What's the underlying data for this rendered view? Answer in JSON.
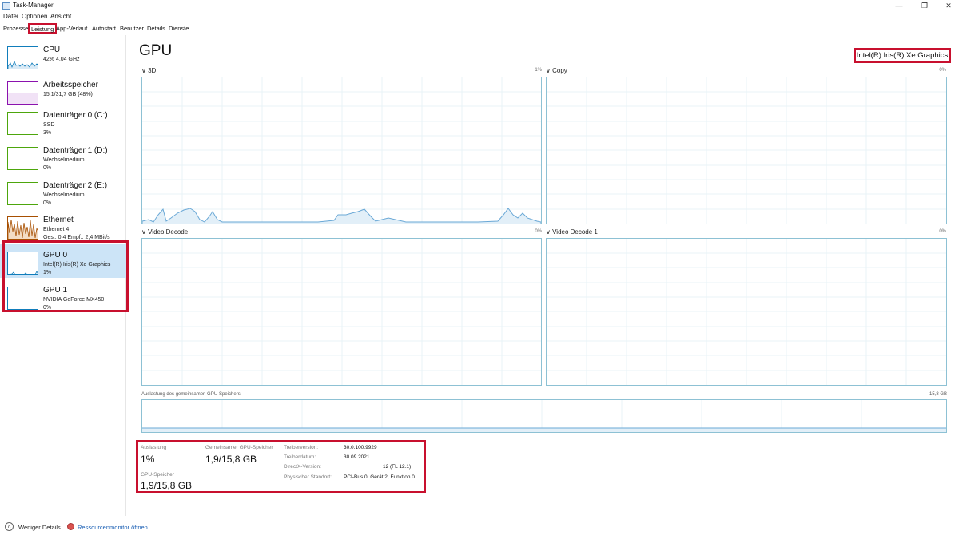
{
  "window": {
    "title": "Task-Manager"
  },
  "menu": [
    "Datei",
    "Optionen",
    "Ansicht"
  ],
  "tabs": [
    {
      "label": "Prozesse",
      "active": false
    },
    {
      "label": "Leistung",
      "active": true
    },
    {
      "label": "App-Verlauf",
      "active": false
    },
    {
      "label": "Autostart",
      "active": false
    },
    {
      "label": "Benutzer",
      "active": false
    },
    {
      "label": "Details",
      "active": false
    },
    {
      "label": "Dienste",
      "active": false
    }
  ],
  "sidebar": {
    "items": [
      {
        "name": "CPU",
        "sub1": "42% 4,04 GHz",
        "sub2": "",
        "color": "#117dbb"
      },
      {
        "name": "Arbeitsspeicher",
        "sub1": "15,1/31,7 GB (48%)",
        "sub2": "",
        "color": "#8b12ae"
      },
      {
        "name": "Datenträger 0 (C:)",
        "sub1": "SSD",
        "sub2": "3%",
        "color": "#4da60c"
      },
      {
        "name": "Datenträger 1 (D:)",
        "sub1": "Wechselmedium",
        "sub2": "0%",
        "color": "#4da60c"
      },
      {
        "name": "Datenträger 2 (E:)",
        "sub1": "Wechselmedium",
        "sub2": "0%",
        "color": "#4da60c"
      },
      {
        "name": "Ethernet",
        "sub1": "Ethernet 4",
        "sub2": "Ges.: 0,4  Empf.: 2,4 MBit/s",
        "color": "#a74f01"
      },
      {
        "name": "GPU 0",
        "sub1": "Intel(R) Iris(R) Xe Graphics",
        "sub2": "1%",
        "color": "#117dbb"
      },
      {
        "name": "GPU 1",
        "sub1": "NVIDIA GeForce MX450",
        "sub2": "0%",
        "color": "#117dbb"
      }
    ],
    "selected_index": 6
  },
  "main": {
    "heading": "GPU",
    "adapter": "Intel(R) Iris(R) Xe Graphics",
    "engines": [
      {
        "label": "3D",
        "percent": "1%"
      },
      {
        "label": "Copy",
        "percent": "0%"
      },
      {
        "label": "Video Decode",
        "percent": "0%"
      },
      {
        "label": "Video Decode 1",
        "percent": "0%"
      }
    ],
    "shared_memory": {
      "label": "Auslastung des gemeinsamen GPU-Speichers",
      "max": "15,8 GB"
    },
    "stats": {
      "utilization_label": "Auslastung",
      "utilization_value": "1%",
      "shared_label": "Gemeinsamer GPU-Speicher",
      "shared_value": "1,9/15,8 GB",
      "gpu_mem_label": "GPU-Speicher",
      "gpu_mem_value": "1,9/15,8 GB",
      "driver_version_label": "Treiberversion:",
      "driver_version": "30.0.100.9929",
      "driver_date_label": "Treiberdatum:",
      "driver_date": "30.09.2021",
      "directx_label": "DirectX-Version:",
      "directx": "12 (FL 12.1)",
      "location_label": "Physischer Standort:",
      "location": "PCI-Bus 0, Gerät 2, Funktion 0"
    }
  },
  "footer": {
    "fewer_details": "Weniger Details",
    "resource_monitor": "Ressourcenmonitor öffnen"
  },
  "colors": {
    "accent": "#117dbb",
    "highlight": "#c8102e",
    "graph_border": "#8dc1d4",
    "selected_bg": "#cce4f7"
  },
  "icons": [
    "app-icon",
    "chevron-down-icon",
    "chevron-up-icon",
    "resource-monitor-icon"
  ]
}
